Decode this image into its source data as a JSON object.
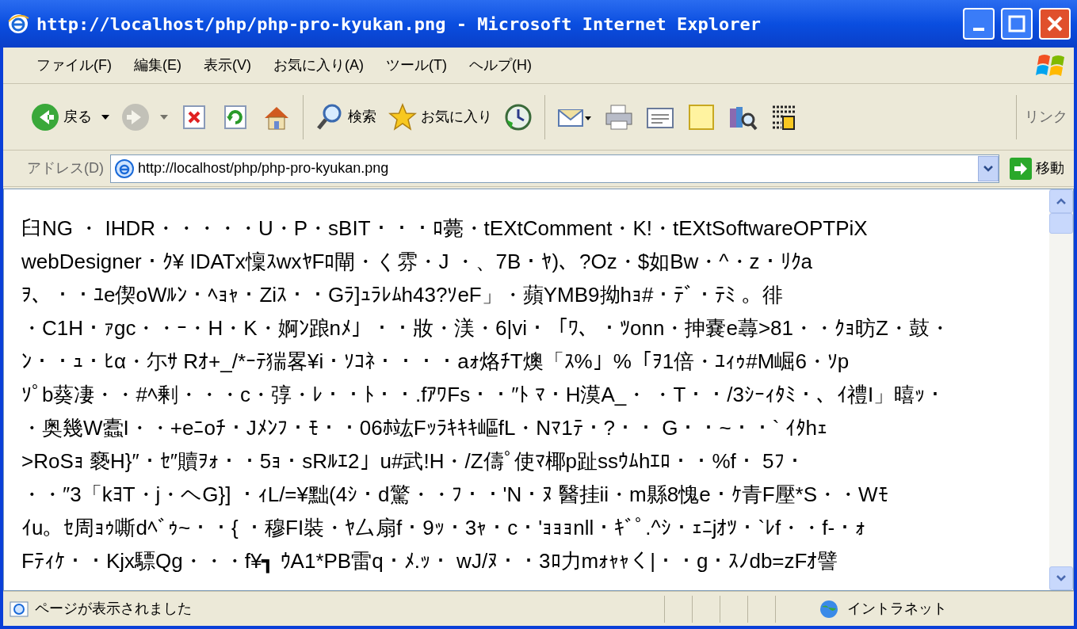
{
  "window": {
    "title": "http://localhost/php/php-pro-kyukan.png - Microsoft Internet Explorer"
  },
  "menu": [
    "ファイル(F)",
    "編集(E)",
    "表示(V)",
    "お気に入り(A)",
    "ツール(T)",
    "ヘルプ(H)"
  ],
  "toolbar": [
    {
      "kind": "back",
      "label": "戻る",
      "disabled": false
    },
    {
      "kind": "forward",
      "disabled": true
    },
    {
      "kind": "stop",
      "disabled": false
    },
    {
      "kind": "refresh",
      "disabled": false
    },
    {
      "kind": "home",
      "disabled": false
    },
    {
      "kind": "search",
      "label": "検索",
      "disabled": false
    },
    {
      "kind": "favorites",
      "label": "お気に入り",
      "disabled": false
    },
    {
      "kind": "history",
      "disabled": false
    },
    {
      "kind": "mail",
      "disabled": false
    },
    {
      "kind": "print",
      "disabled": false
    },
    {
      "kind": "edit",
      "disabled": false
    },
    {
      "kind": "note",
      "disabled": false
    },
    {
      "kind": "research",
      "disabled": false
    },
    {
      "kind": "messenger",
      "disabled": false
    }
  ],
  "links_label": "リンク",
  "address": {
    "label": "アドレス(D)",
    "value": "http://localhost/php/php-pro-kyukan.png",
    "go": "移動"
  },
  "content": {
    "lines": [
      "臼NG ・ IHDR・・・・・U・P・sBIT・・・ﾛ薨・tEXtComment・K!・tEXtSoftwareOPTPiX",
      "webDesigner・ｸ¥ IDATx懍ｽwxﾔFﾛ閘・く雰・J ・、7B・ﾔ)、?Oz・$如Bw・^・z・ﾘｸa",
      "ｦ、・・ﾕe偰oWﾙﾝ・ﾍｮｬ・Ziｽ・・Gﾗ]ｭﾗﾚﾑh43?ｿeF」・蘋YMB9拗hｮ#・ﾃﾞ・ﾃﾐ 。徘",
      "・C1H・ｧgc・・ｰ・H・K・婀ﾝ踉nﾒ」・・妝・渼・6|vi・「ﾜ、・ﾂonn・抻嚢e蕁>81・・ｸｮ昉Z・鼓・",
      "ﾝ・・ｭ・ﾋα・尓ｻ Rｵ+_/*ｰﾃ猯畧¥i・ｿｺﾈ・・・・aｫ烙ﾁT燠「ｽ%」%「ｦ1倍・ﾕｨｩ#M崛6・ｿp",
      "ｿﾟb葵凄・・#ﾍ剰・・・c・弴・ﾚ・・ﾄ・・.fｱﾜFs・・″ﾄ ﾏ・H漠A_・ ・T・・/3ｼｰｨﾀﾐ・、ｲ禮I」暿ｯ・",
      "・奥幾W蠹I・・+eﾆoﾁ・Jﾒﾝﾌ・ﾓ・・06ﾎ竑Fｯﾗｷｷｷ嶇fL・Nﾏ1ﾃ・?・・ G・・~・・` ｲﾀhｪ",
      ">RoSｮ 褻H}″・ｾ″贖ｦｫ・・5ｮ・sRﾙｴ2」u#武!H・/Z儔ﾟ使ﾏ椰p趾ssｳﾑhｴﾛ・・%f・ 5ﾌ・",
      "・・″3「kﾖT・j・ヘG}] ・ｨL/=¥黜(4ｼ・d驚・・ﾌ・・'N・ﾇ 醫挂ii・m縣8愧e・ｹ青F壓*S・・Wﾓ",
      "ｲu。ｾ周ｮｩ嘶dﾍﾞｩ~・・{ ・穆FI裝・ﾔ厶扇f・9ｯ・3ｬ・c・'ｮｮｮnll・ｷﾞﾟ.^ｼ・ｪﾆjｵﾂ・`ﾚf・・f-・ｫ",
      "Fﾃｨｹ・・Kjx驃Qg・・・f¥┓ ｳA1*PB雷q・ﾒ.ｯ・ wJ/ﾇ・・3ﾛ力mｫｬｬく|・・g・ｽﾉdb=zFｵ譬"
    ]
  },
  "status_bar": {
    "text": "ページが表示されました",
    "zone": "イントラネット"
  }
}
